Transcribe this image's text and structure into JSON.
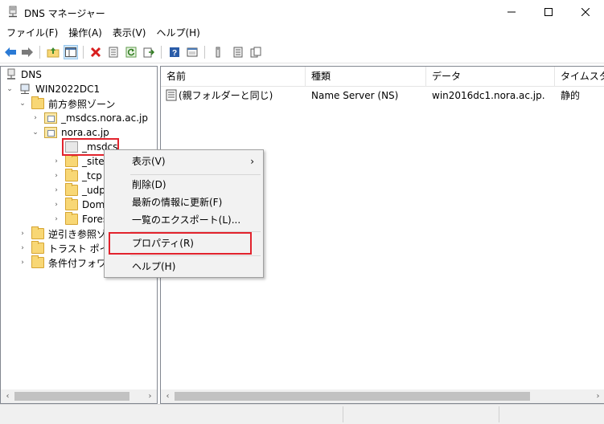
{
  "window": {
    "title": "DNS マネージャー",
    "app_icon": "dns-server-icon",
    "controls": {
      "minimize": "—",
      "maximize": "☐",
      "close": "✕"
    }
  },
  "menu": [
    "ファイル(F)",
    "操作(A)",
    "表示(V)",
    "ヘルプ(H)"
  ],
  "toolbar": {
    "buttons": [
      "back-arrow-icon",
      "forward-arrow-icon",
      "up-folder-icon",
      "show-hide-console-tree-icon",
      "delete-icon",
      "properties-icon",
      "refresh-icon",
      "export-list-icon",
      "help-icon",
      "console-icon",
      "server-icon",
      "list-icon",
      "copy-icon"
    ]
  },
  "tree": {
    "root": "DNS",
    "server": "WIN2022DC1",
    "forward_zones": "前方参照ゾーン",
    "zone_msdcs": "_msdcs.nora.ac.jp",
    "zone_nora": "nora.ac.jp",
    "selected": "_msdcs",
    "sites": "_sites",
    "tcp": "_tcp",
    "udp": "_udp",
    "domain": "Doma",
    "forest": "Fores",
    "reverse_zones": "逆引き参照ゾ",
    "trust_points": "トラスト ポイン",
    "conditional": "条件付フォワー"
  },
  "list": {
    "columns": [
      "名前",
      "種類",
      "データ",
      "タイムスタン"
    ],
    "rows": [
      {
        "name": "(親フォルダーと同じ)",
        "type": "Name Server (NS)",
        "data": "win2016dc1.nora.ac.jp.",
        "timestamp": "静的"
      }
    ]
  },
  "context_menu": {
    "view": "表示(V)",
    "delete": "削除(D)",
    "refresh": "最新の情報に更新(F)",
    "export": "一覧のエクスポート(L)...",
    "properties": "プロパティ(R)",
    "help": "ヘルプ(H)",
    "submenu_indicator": "›"
  },
  "colors": {
    "highlight_border": "#e2232d",
    "folder": "#f8d775",
    "selection_bg": "#cce4f7"
  }
}
